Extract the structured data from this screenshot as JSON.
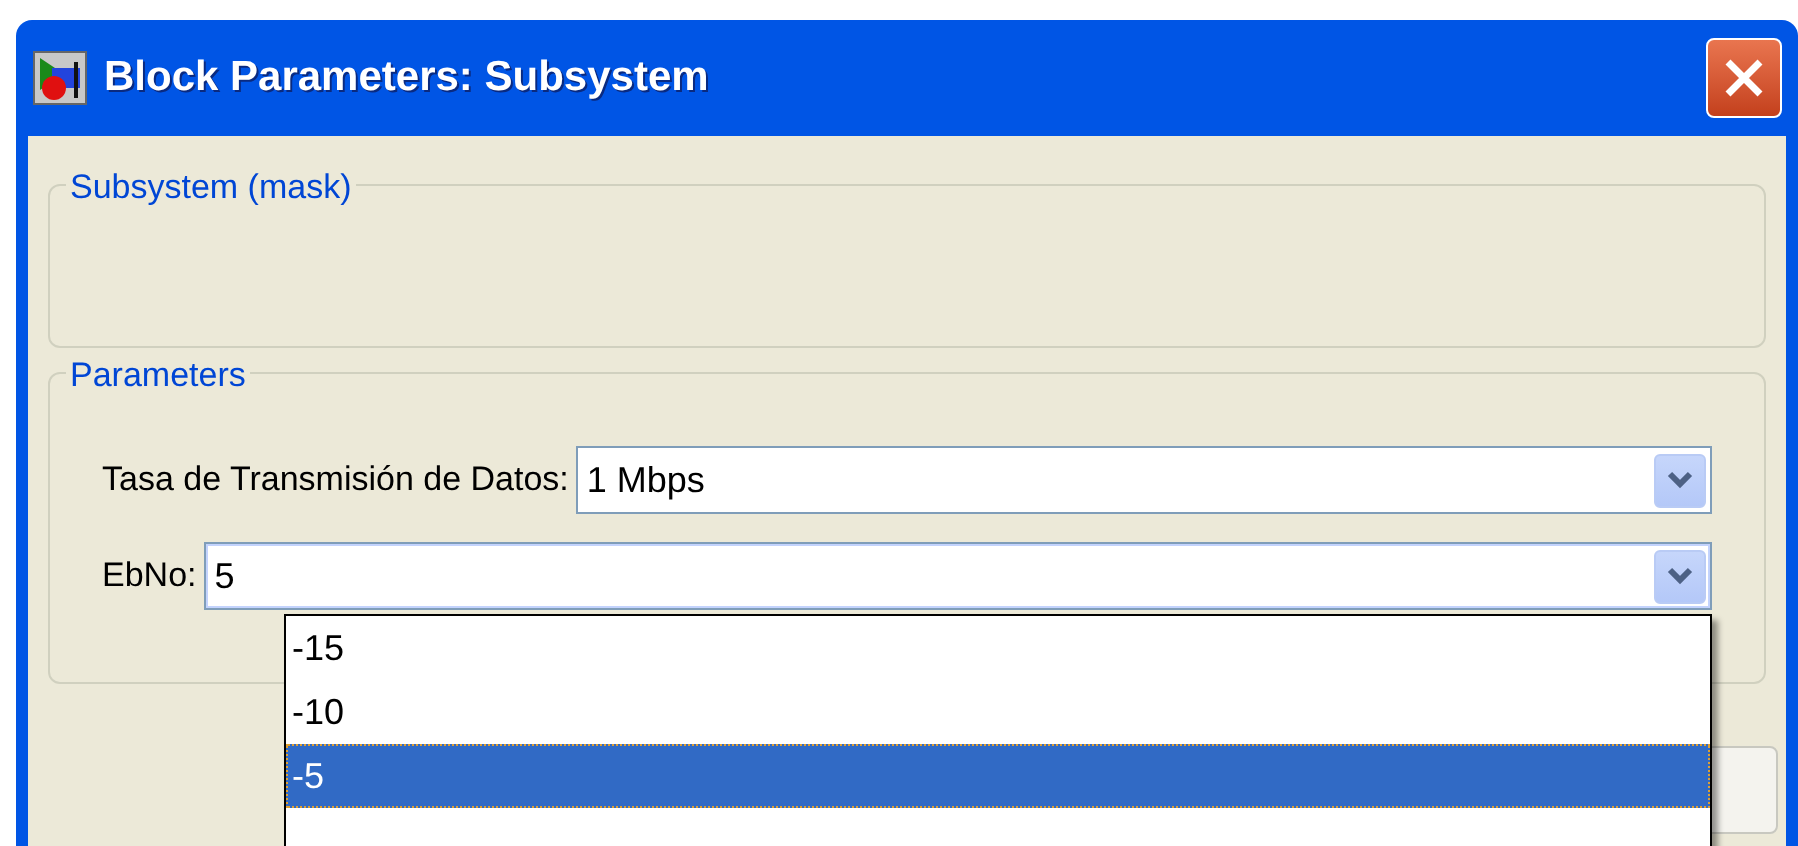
{
  "window": {
    "title": "Block Parameters: Subsystem"
  },
  "groups": [
    {
      "title": "Subsystem (mask)"
    },
    {
      "title": "Parameters",
      "fields": [
        {
          "label": "Tasa de Transmisión de Datos:",
          "value": "1 Mbps",
          "expanded": false
        },
        {
          "label": "EbNo:",
          "value": "5",
          "expanded": true
        }
      ]
    }
  ],
  "dropdown_list": {
    "items": [
      {
        "text": "-15",
        "selected": false
      },
      {
        "text": "-10",
        "selected": false
      },
      {
        "text": "-5",
        "selected": true
      }
    ]
  }
}
